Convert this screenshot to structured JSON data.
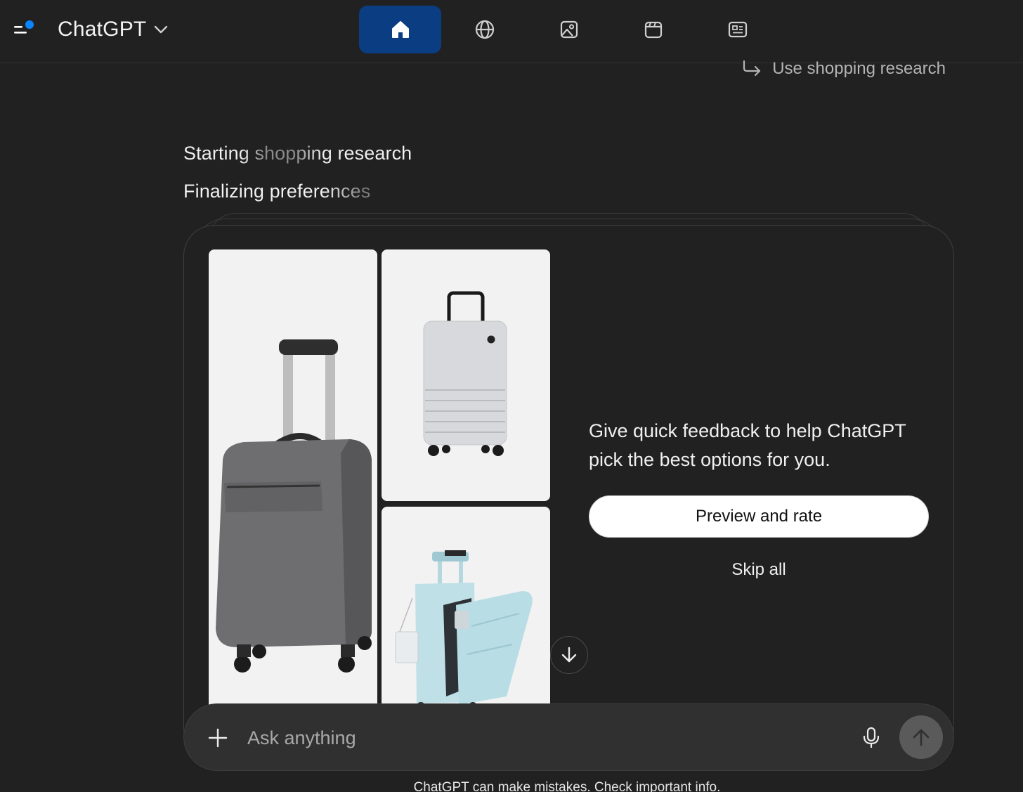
{
  "app": {
    "title": "ChatGPT",
    "accent_color": "#0b84ff",
    "active_tab_color": "#0b3d82"
  },
  "nav": {
    "tabs": [
      {
        "icon": "home-icon",
        "active": true
      },
      {
        "icon": "globe-icon",
        "active": false
      },
      {
        "icon": "image-icon",
        "active": false
      },
      {
        "icon": "video-icon",
        "active": false
      },
      {
        "icon": "news-icon",
        "active": false
      }
    ]
  },
  "shortcut": {
    "label": "Use shopping research",
    "icon": "reply-arrow-icon"
  },
  "status": {
    "line1": "Starting shopping research",
    "line2": "Finalizing preferences"
  },
  "feedback_card": {
    "products": [
      {
        "icon": "gray-soft-suitcase-image"
      },
      {
        "icon": "white-hardshell-suitcase-image"
      },
      {
        "icon": "light-blue-suitcase-image"
      }
    ],
    "prompt": "Give quick feedback to help ChatGPT pick the best options for you.",
    "primary_button": "Preview and rate",
    "secondary_button": "Skip all"
  },
  "composer": {
    "placeholder": "Ask anything",
    "value": ""
  },
  "footer": {
    "disclaimer": "ChatGPT can make mistakes. Check important info."
  }
}
